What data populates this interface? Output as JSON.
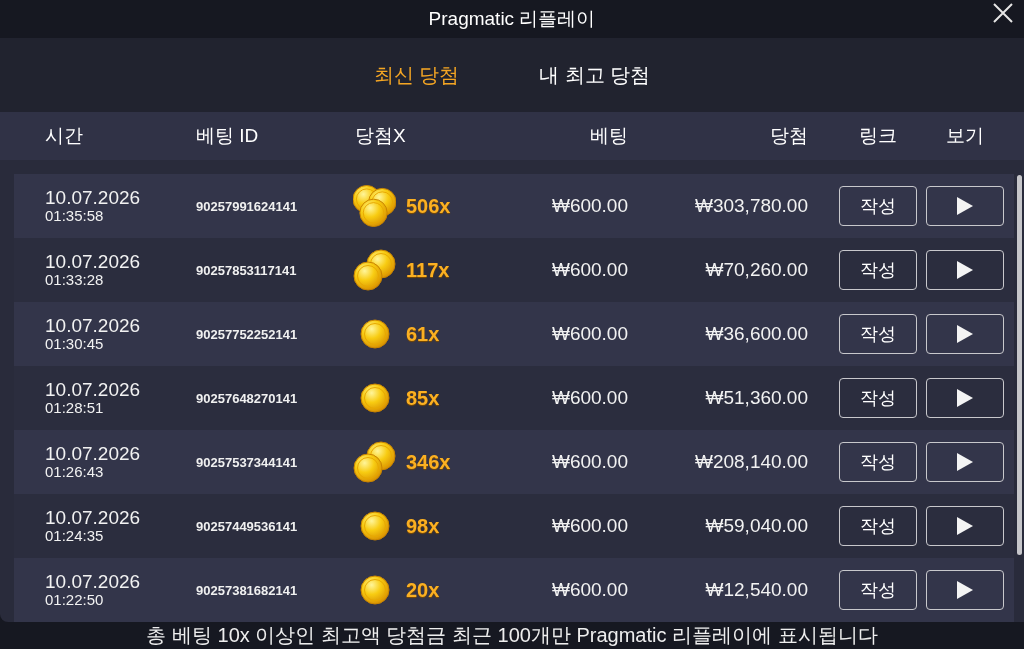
{
  "window": {
    "title": "Pragmatic 리플레이"
  },
  "tabs": [
    {
      "label": "최신 당첨",
      "selected": true
    },
    {
      "label": "내 최고 당첨",
      "selected": false
    }
  ],
  "table": {
    "columns": [
      "시간",
      "베팅 ID",
      "당첨X",
      "베팅",
      "당첨",
      "링크",
      "보기"
    ],
    "rows": [
      {
        "date": "10.07.2026",
        "time": "01:35:58",
        "bet_id": "90257991624141",
        "kind": "triple",
        "multiplier": "506x",
        "bet": "₩600.00",
        "win": "₩303,780.00",
        "link": "작성"
      },
      {
        "date": "10.07.2026",
        "time": "01:33:28",
        "bet_id": "90257853117141",
        "kind": "double",
        "multiplier": "117x",
        "bet": "₩600.00",
        "win": "₩70,260.00",
        "link": "작성"
      },
      {
        "date": "10.07.2026",
        "time": "01:30:45",
        "bet_id": "90257752252141",
        "kind": "single",
        "multiplier": "61x",
        "bet": "₩600.00",
        "win": "₩36,600.00",
        "link": "작성"
      },
      {
        "date": "10.07.2026",
        "time": "01:28:51",
        "bet_id": "90257648270141",
        "kind": "single",
        "multiplier": "85x",
        "bet": "₩600.00",
        "win": "₩51,360.00",
        "link": "작성"
      },
      {
        "date": "10.07.2026",
        "time": "01:26:43",
        "bet_id": "90257537344141",
        "kind": "double",
        "multiplier": "346x",
        "bet": "₩600.00",
        "win": "₩208,140.00",
        "link": "작성"
      },
      {
        "date": "10.07.2026",
        "time": "01:24:35",
        "bet_id": "90257449536141",
        "kind": "single",
        "multiplier": "98x",
        "bet": "₩600.00",
        "win": "₩59,040.00",
        "link": "작성"
      },
      {
        "date": "10.07.2026",
        "time": "01:22:50",
        "bet_id": "90257381682141",
        "kind": "single",
        "multiplier": "20x",
        "bet": "₩600.00",
        "win": "₩12,540.00",
        "link": "작성"
      }
    ]
  },
  "footer": {
    "note": "총 베팅 10x 이상인 최고액 당첨금 최근 100개만 Pragmatic 리플레이에 표시됩니다"
  }
}
